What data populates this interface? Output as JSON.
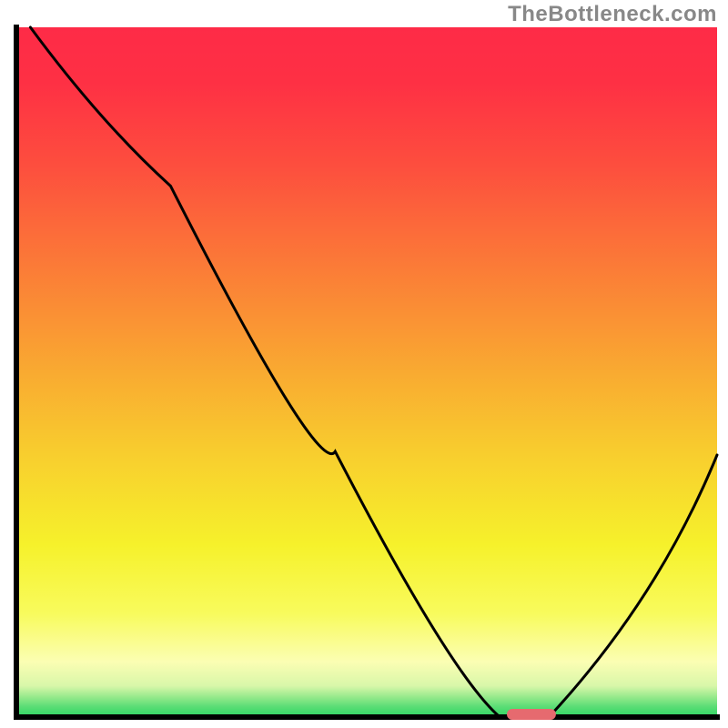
{
  "watermark": "TheBottleneck.com",
  "chart_data": {
    "type": "line",
    "title": "",
    "xlabel": "",
    "ylabel": "",
    "xlim": [
      0,
      100
    ],
    "ylim": [
      0,
      100
    ],
    "x": [
      2,
      22,
      69,
      76,
      100
    ],
    "values": [
      100,
      77,
      0,
      0,
      38
    ],
    "marker": {
      "x_start": 70,
      "x_end": 77,
      "y": 0
    },
    "grid": false,
    "legend": false,
    "annotations": [],
    "axis_ticks": {
      "x": [],
      "y": []
    },
    "gradient_stops": [
      {
        "offset": 0.0,
        "color": "#fe2b47"
      },
      {
        "offset": 0.08,
        "color": "#fe3044"
      },
      {
        "offset": 0.2,
        "color": "#fd4e3e"
      },
      {
        "offset": 0.35,
        "color": "#fb7c37"
      },
      {
        "offset": 0.5,
        "color": "#f9aa31"
      },
      {
        "offset": 0.62,
        "color": "#f8ce2e"
      },
      {
        "offset": 0.75,
        "color": "#f6f12b"
      },
      {
        "offset": 0.85,
        "color": "#f8fb5d"
      },
      {
        "offset": 0.92,
        "color": "#fbfeb3"
      },
      {
        "offset": 0.955,
        "color": "#d8f7a9"
      },
      {
        "offset": 0.97,
        "color": "#9aea8d"
      },
      {
        "offset": 0.985,
        "color": "#5add75"
      },
      {
        "offset": 1.0,
        "color": "#2fd564"
      }
    ],
    "marker_color": "#e66a6f",
    "curve_color": "#000000",
    "frame_color": "#000000"
  }
}
